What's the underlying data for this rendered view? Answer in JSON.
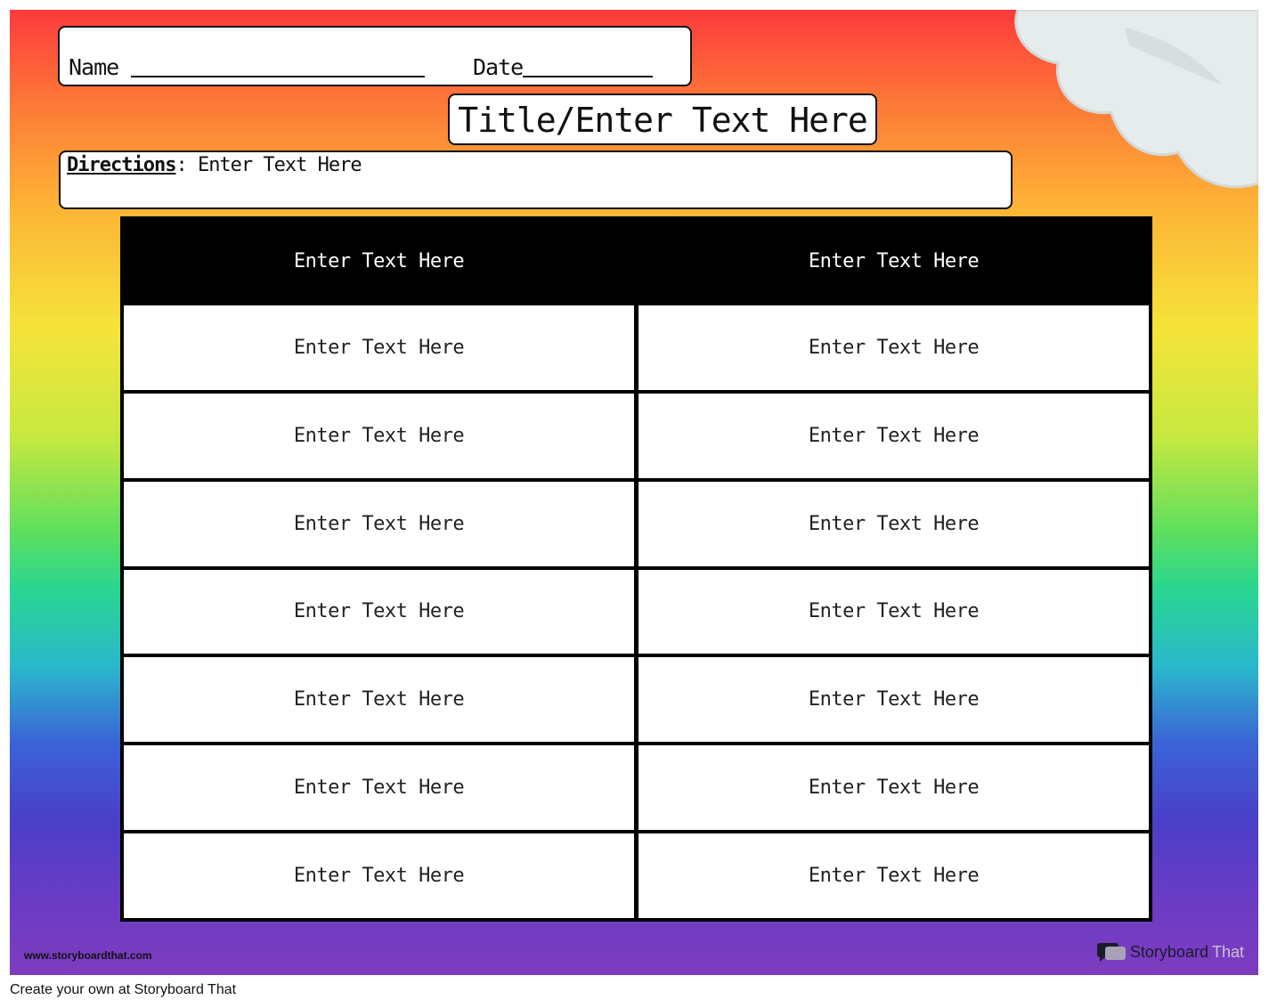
{
  "header": {
    "name_label": "Name",
    "date_label": "Date",
    "title": "Title/Enter Text Here",
    "directions_label": "Directions",
    "directions_text": ": Enter Text Here"
  },
  "table": {
    "headers": [
      "Enter Text Here",
      "Enter Text Here"
    ],
    "rows": [
      [
        "Enter Text Here",
        "Enter Text Here"
      ],
      [
        "Enter Text Here",
        "Enter Text Here"
      ],
      [
        "Enter Text Here",
        "Enter Text Here"
      ],
      [
        "Enter Text Here",
        "Enter Text Here"
      ],
      [
        "Enter Text Here",
        "Enter Text Here"
      ],
      [
        "Enter Text Here",
        "Enter Text Here"
      ],
      [
        "Enter Text Here",
        "Enter Text Here"
      ]
    ]
  },
  "footer": {
    "url": "www.storyboardthat.com",
    "brand_part1": "Storyboard",
    "brand_part2": "That",
    "logo_icon": "speech-bubble-icon",
    "caption": "Create your own at Storyboard That"
  },
  "decor": {
    "cloud_icon": "cloud-icon"
  }
}
